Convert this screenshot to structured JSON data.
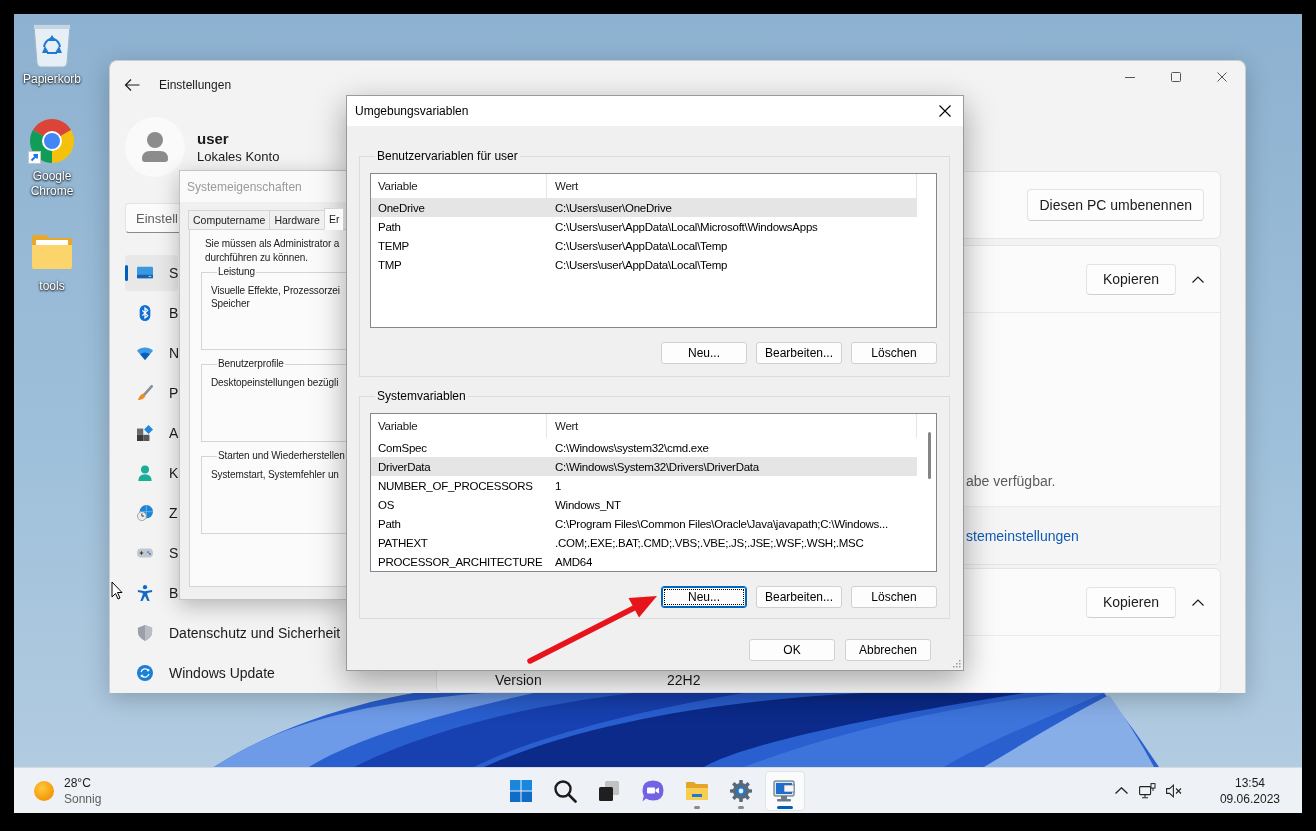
{
  "desktop_icons": [
    {
      "label": "Papierkorb",
      "kind": "recycle-bin"
    },
    {
      "label": "Google Chrome",
      "kind": "browser"
    },
    {
      "label": "tools",
      "kind": "folder"
    }
  ],
  "settings_window": {
    "title": "Einstellungen",
    "account": {
      "name": "user",
      "type": "Lokales Konto"
    },
    "search": {
      "placeholder": "Einstell"
    },
    "nav": [
      {
        "label": "S",
        "kind": "system",
        "selected": true
      },
      {
        "label": "B",
        "kind": "bluetooth",
        "selected": false
      },
      {
        "label": "N",
        "kind": "network",
        "selected": false
      },
      {
        "label": "P",
        "kind": "personalization",
        "selected": false
      },
      {
        "label": "A",
        "kind": "apps",
        "selected": false
      },
      {
        "label": "K",
        "kind": "accounts",
        "selected": false
      },
      {
        "label": "Z",
        "kind": "time-language",
        "selected": false
      },
      {
        "label": "S",
        "kind": "gaming",
        "selected": false
      },
      {
        "label": "B",
        "kind": "accessibility",
        "selected": false
      },
      {
        "label": "Datenschutz und Sicherheit",
        "kind": "privacy",
        "selected": false
      },
      {
        "label": "Windows Update",
        "kind": "update",
        "selected": false
      }
    ],
    "rename_button": "Diesen PC umbenennen",
    "sections": [
      {
        "button": "Kopieren",
        "expanded": true,
        "note": "abe verfügbar.",
        "link": "stemeinstellungen"
      },
      {
        "button": "Kopieren",
        "expanded": true,
        "rows": [
          {
            "label": "Version",
            "value": "22H2"
          }
        ]
      }
    ]
  },
  "system_properties": {
    "title": "Systemeigenschaften",
    "tabs": [
      {
        "label": "Computername",
        "selected": false
      },
      {
        "label": "Hardware",
        "selected": false
      },
      {
        "label": "Er",
        "selected": true
      }
    ],
    "notice": [
      "Sie müssen als Administrator a",
      "durchführen zu können."
    ],
    "groups": [
      {
        "title": "Leistung",
        "text": [
          "Visuelle Effekte, Prozessorzei",
          "Speicher"
        ]
      },
      {
        "title": "Benutzerprofile",
        "text": [
          "Desktopeinstellungen bezügli"
        ]
      },
      {
        "title": "Starten und Wiederherstellen",
        "text": [
          "Systemstart, Systemfehler un"
        ]
      }
    ]
  },
  "environment_dialog": {
    "title": "Umgebungsvariablen",
    "sections": [
      {
        "title": "Benutzervariablen für user",
        "columns": [
          "Variable",
          "Wert"
        ],
        "rows": [
          {
            "variable": "OneDrive",
            "value": "C:\\Users\\user\\OneDrive",
            "selected": true
          },
          {
            "variable": "Path",
            "value": "C:\\Users\\user\\AppData\\Local\\Microsoft\\WindowsApps",
            "selected": false
          },
          {
            "variable": "TEMP",
            "value": "C:\\Users\\user\\AppData\\Local\\Temp",
            "selected": false
          },
          {
            "variable": "TMP",
            "value": "C:\\Users\\user\\AppData\\Local\\Temp",
            "selected": false
          }
        ],
        "buttons": [
          {
            "label": "Neu...",
            "focused": false
          },
          {
            "label": "Bearbeiten...",
            "focused": false
          },
          {
            "label": "Löschen",
            "focused": false
          }
        ]
      },
      {
        "title": "Systemvariablen",
        "columns": [
          "Variable",
          "Wert"
        ],
        "rows": [
          {
            "variable": "ComSpec",
            "value": "C:\\Windows\\system32\\cmd.exe",
            "selected": false
          },
          {
            "variable": "DriverData",
            "value": "C:\\Windows\\System32\\Drivers\\DriverData",
            "selected": true
          },
          {
            "variable": "NUMBER_OF_PROCESSORS",
            "value": "1",
            "selected": false
          },
          {
            "variable": "OS",
            "value": "Windows_NT",
            "selected": false
          },
          {
            "variable": "Path",
            "value": "C:\\Program Files\\Common Files\\Oracle\\Java\\javapath;C:\\Windows...",
            "selected": false
          },
          {
            "variable": "PATHEXT",
            "value": ".COM;.EXE;.BAT;.CMD;.VBS;.VBE;.JS;.JSE;.WSF;.WSH;.MSC",
            "selected": false
          },
          {
            "variable": "PROCESSOR_ARCHITECTURE",
            "value": "AMD64",
            "selected": false
          }
        ],
        "buttons": [
          {
            "label": "Neu...",
            "focused": true
          },
          {
            "label": "Bearbeiten...",
            "focused": false
          },
          {
            "label": "Löschen",
            "focused": false
          }
        ]
      }
    ],
    "buttons": [
      "OK",
      "Abbrechen"
    ]
  },
  "taskbar": {
    "weather": {
      "temperature": "28°C",
      "condition": "Sonnig"
    },
    "apps": [
      {
        "kind": "start",
        "running": false,
        "active": false
      },
      {
        "kind": "search",
        "running": false,
        "active": false
      },
      {
        "kind": "task-view",
        "running": false,
        "active": false
      },
      {
        "kind": "chat",
        "running": false,
        "active": false
      },
      {
        "kind": "file-explorer",
        "running": true,
        "active": false
      },
      {
        "kind": "settings",
        "running": true,
        "active": false
      },
      {
        "kind": "system-properties",
        "running": true,
        "active": true
      }
    ],
    "clock": {
      "time": "13:54",
      "date": "09.06.2023"
    }
  }
}
